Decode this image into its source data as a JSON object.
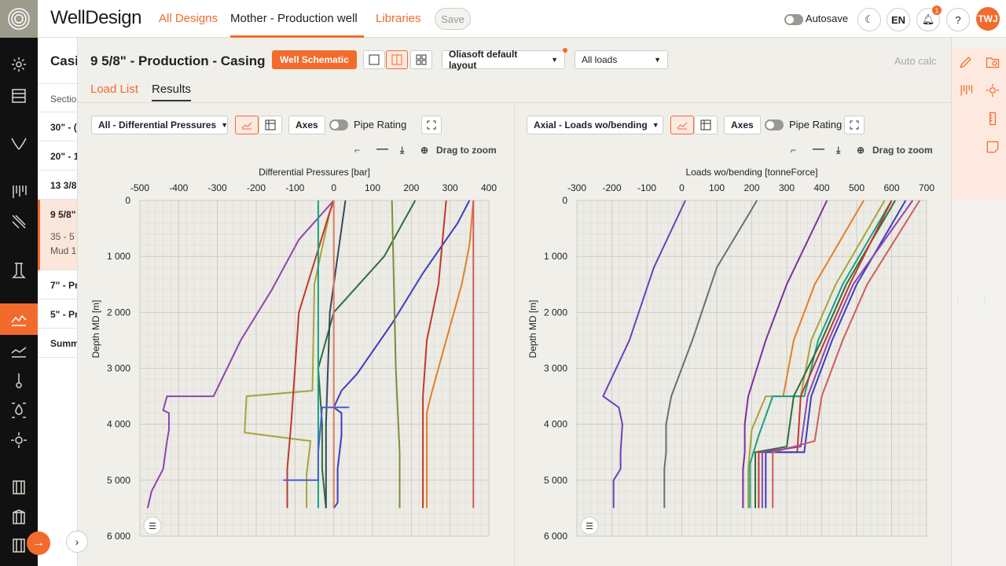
{
  "app": {
    "brand": "WellDesign",
    "nav": [
      "All Designs",
      "Mother - Production well",
      "Libraries"
    ],
    "save": "Save",
    "autosave": "Autosave",
    "lang": "EN",
    "notifications": "1",
    "help": "?",
    "user": "TWJ"
  },
  "sections": {
    "title": "Casi",
    "header": "Sectio",
    "items": [
      "30\" - (",
      "20\" - 1",
      "13 3/8",
      "9 5/8\"",
      "7\" - Pr",
      "5\" - Pr",
      "Summ"
    ],
    "active_sub1": "35 - 5",
    "active_sub2": "Mud 1"
  },
  "main": {
    "title": "9 5/8\" - Production - Casing",
    "schematic_button": "Well Schematic",
    "layout_dropdown": "Oliasoft default layout",
    "loads_dropdown": "All loads",
    "auto_calc": "Auto calc",
    "tabs": [
      "Load List",
      "Results"
    ]
  },
  "left_panel": {
    "dropdown": "All - Differential Pressures",
    "axes": "Axes",
    "pipe_rating": "Pipe Rating",
    "drag_zoom": "Drag to zoom"
  },
  "right_panel": {
    "dropdown": "Axial - Loads wo/bending",
    "axes": "Axes",
    "pipe_rating": "Pipe Rating",
    "drag_zoom": "Drag to zoom"
  },
  "icons": [
    "settings-icon",
    "layers-icon",
    "trajectory-icon",
    "casing-icon",
    "formation-icon",
    "pipe-icon",
    "chart-icon",
    "line-chart-icon",
    "thermometer-icon",
    "fluid-icon",
    "gear-icon",
    "barrel-icon",
    "pencil-icon",
    "search-folder-icon",
    "ruler-icon",
    "note-icon"
  ],
  "colors": {
    "accent": "#f26b2d",
    "rail": "#111111",
    "panel_bg": "#f0efea"
  },
  "chart_data": [
    {
      "type": "line",
      "title": "Differential Pressures [bar]",
      "xlabel": "Differential Pressures [bar]",
      "ylabel": "Depth MD [m]",
      "xlim": [
        -500,
        400
      ],
      "ylim": [
        6000,
        0
      ],
      "xticks": [
        -500,
        -400,
        -300,
        -200,
        -100,
        0,
        100,
        200,
        300,
        400
      ],
      "yticks": [
        0,
        1000,
        2000,
        3000,
        4000,
        5000,
        6000
      ],
      "ytick_labels": [
        "0",
        "1 000",
        "2 000",
        "3 000",
        "4 000",
        "5 000",
        "6 000"
      ],
      "grid": true,
      "series": [
        {
          "color": "#8e44ad",
          "points": [
            [
              -480,
              5500
            ],
            [
              -470,
              5200
            ],
            [
              -440,
              4800
            ],
            [
              -430,
              4300
            ],
            [
              -425,
              4100
            ],
            [
              -425,
              3800
            ],
            [
              -440,
              3750
            ],
            [
              -430,
              3500
            ],
            [
              -310,
              3500
            ],
            [
              -240,
              2500
            ],
            [
              -160,
              1600
            ],
            [
              -90,
              700
            ],
            [
              0,
              0
            ]
          ]
        },
        {
          "color": "#3a3fbf",
          "points": [
            [
              0,
              5500
            ],
            [
              10,
              5400
            ],
            [
              10,
              4800
            ],
            [
              20,
              4200
            ],
            [
              20,
              3800
            ],
            [
              0,
              3700
            ],
            [
              20,
              3400
            ],
            [
              60,
              3100
            ],
            [
              150,
              2200
            ],
            [
              230,
              1300
            ],
            [
              320,
              400
            ],
            [
              350,
              0
            ]
          ]
        },
        {
          "color": "#a8a33a",
          "points": [
            [
              -70,
              5500
            ],
            [
              -70,
              4900
            ],
            [
              -60,
              4300
            ],
            [
              -230,
              4150
            ],
            [
              -225,
              3500
            ],
            [
              -55,
              3400
            ],
            [
              -50,
              1500
            ],
            [
              -10,
              200
            ],
            [
              0,
              0
            ]
          ]
        },
        {
          "color": "#c0392b",
          "points": [
            [
              -120,
              5500
            ],
            [
              -120,
              4800
            ],
            [
              -110,
              4000
            ],
            [
              -90,
              2000
            ],
            [
              -10,
              200
            ],
            [
              0,
              0
            ]
          ]
        },
        {
          "color": "#2c6e3f",
          "points": [
            [
              -20,
              5500
            ],
            [
              -30,
              4800
            ],
            [
              -30,
              4000
            ],
            [
              -40,
              3000
            ],
            [
              0,
              2000
            ],
            [
              130,
              1000
            ],
            [
              210,
              0
            ]
          ]
        },
        {
          "color": "#16a085",
          "points": [
            [
              -40,
              5500
            ],
            [
              -40,
              3000
            ],
            [
              -40,
              0
            ]
          ]
        },
        {
          "color": "#e67e22",
          "points": [
            [
              240,
              5500
            ],
            [
              240,
              3800
            ],
            [
              250,
              3500
            ],
            [
              290,
              2500
            ],
            [
              330,
              1500
            ],
            [
              350,
              800
            ],
            [
              360,
              0
            ]
          ]
        },
        {
          "color": "#c0392b",
          "points": [
            [
              230,
              5500
            ],
            [
              230,
              4200
            ],
            [
              230,
              3500
            ],
            [
              240,
              2500
            ],
            [
              270,
              1500
            ],
            [
              290,
              0
            ]
          ]
        },
        {
          "color": "#7f8c3a",
          "points": [
            [
              170,
              5500
            ],
            [
              170,
              4500
            ],
            [
              160,
              3000
            ],
            [
              150,
              0
            ]
          ]
        },
        {
          "color": "#d35b5b",
          "points": [
            [
              360,
              5500
            ],
            [
              360,
              4000
            ],
            [
              360,
              2000
            ],
            [
              360,
              0
            ]
          ]
        },
        {
          "color": "#34495e",
          "points": [
            [
              -20,
              5500
            ],
            [
              -20,
              4000
            ],
            [
              -10,
              2000
            ],
            [
              30,
              0
            ]
          ]
        },
        {
          "color": "#e07a5f",
          "points": [
            [
              0,
              5500
            ],
            [
              0,
              0
            ]
          ]
        },
        {
          "color": "#4a5fd1",
          "points": [
            [
              -130,
              5000
            ],
            [
              -40,
              5000
            ],
            [
              -40,
              4500
            ],
            [
              -30,
              3700
            ],
            [
              40,
              3700
            ]
          ]
        }
      ]
    },
    {
      "type": "line",
      "title": "Loads wo/bending [tonneForce]",
      "xlabel": "Loads wo/bending [tonneForce]",
      "ylabel": "Depth MD [m]",
      "xlim": [
        -300,
        700
      ],
      "ylim": [
        6000,
        0
      ],
      "xticks": [
        -300,
        -200,
        -100,
        0,
        100,
        200,
        300,
        400,
        500,
        600,
        700
      ],
      "yticks": [
        0,
        1000,
        2000,
        3000,
        4000,
        5000,
        6000
      ],
      "ytick_labels": [
        "0",
        "1 000",
        "2 000",
        "3 000",
        "4 000",
        "5 000",
        "6 000"
      ],
      "grid": true,
      "series": [
        {
          "color": "#6b3fbf",
          "points": [
            [
              -195,
              5500
            ],
            [
              -195,
              5000
            ],
            [
              -175,
              4800
            ],
            [
              -175,
              4500
            ],
            [
              -170,
              4000
            ],
            [
              -180,
              3700
            ],
            [
              -225,
              3500
            ],
            [
              -150,
              2500
            ],
            [
              -80,
              1200
            ],
            [
              10,
              0
            ]
          ]
        },
        {
          "color": "#667073",
          "points": [
            [
              -50,
              5500
            ],
            [
              -50,
              4800
            ],
            [
              -45,
              4500
            ],
            [
              -45,
              4000
            ],
            [
              -30,
              3500
            ],
            [
              30,
              2500
            ],
            [
              100,
              1200
            ],
            [
              215,
              0
            ]
          ]
        },
        {
          "color": "#7d2f9e",
          "points": [
            [
              175,
              5500
            ],
            [
              175,
              4800
            ],
            [
              180,
              4500
            ],
            [
              180,
              4000
            ],
            [
              190,
              3500
            ],
            [
              240,
              2500
            ],
            [
              300,
              1500
            ],
            [
              415,
              0
            ]
          ]
        },
        {
          "color": "#e67e22",
          "points": [
            [
              290,
              3500
            ],
            [
              320,
              2500
            ],
            [
              380,
              1500
            ],
            [
              520,
              0
            ]
          ]
        },
        {
          "color": "#a8a33a",
          "points": [
            [
              190,
              5500
            ],
            [
              190,
              4800
            ],
            [
              200,
              4100
            ],
            [
              240,
              3500
            ],
            [
              340,
              3500
            ],
            [
              370,
              2500
            ],
            [
              440,
              1500
            ],
            [
              580,
              0
            ]
          ]
        },
        {
          "color": "#16a085",
          "points": [
            [
              195,
              5500
            ],
            [
              195,
              4700
            ],
            [
              220,
              4200
            ],
            [
              260,
              3500
            ],
            [
              350,
              3500
            ],
            [
              390,
              2500
            ],
            [
              460,
              1500
            ],
            [
              600,
              0
            ]
          ]
        },
        {
          "color": "#2c6e3f",
          "points": [
            [
              210,
              5500
            ],
            [
              210,
              4500
            ],
            [
              300,
              4400
            ],
            [
              320,
              3500
            ],
            [
              400,
              2500
            ],
            [
              470,
              1500
            ],
            [
              610,
              0
            ]
          ]
        },
        {
          "color": "#c0392b",
          "points": [
            [
              220,
              5500
            ],
            [
              220,
              4500
            ],
            [
              330,
              4500
            ],
            [
              340,
              3500
            ],
            [
              410,
              2500
            ],
            [
              480,
              1500
            ],
            [
              600,
              0
            ]
          ]
        },
        {
          "color": "#3a3fbf",
          "points": [
            [
              240,
              5500
            ],
            [
              240,
              4500
            ],
            [
              350,
              4500
            ],
            [
              370,
              3500
            ],
            [
              430,
              2500
            ],
            [
              500,
              1500
            ],
            [
              640,
              0
            ]
          ]
        },
        {
          "color": "#d35b5b",
          "points": [
            [
              260,
              5500
            ],
            [
              260,
              4500
            ],
            [
              380,
              4300
            ],
            [
              400,
              3500
            ],
            [
              460,
              2500
            ],
            [
              530,
              1500
            ],
            [
              680,
              0
            ]
          ]
        },
        {
          "color": "#8e44ad",
          "points": [
            [
              230,
              5500
            ],
            [
              230,
              4500
            ],
            [
              340,
              4400
            ],
            [
              360,
              3500
            ],
            [
              420,
              2500
            ],
            [
              490,
              1500
            ],
            [
              660,
              0
            ]
          ]
        }
      ]
    }
  ]
}
